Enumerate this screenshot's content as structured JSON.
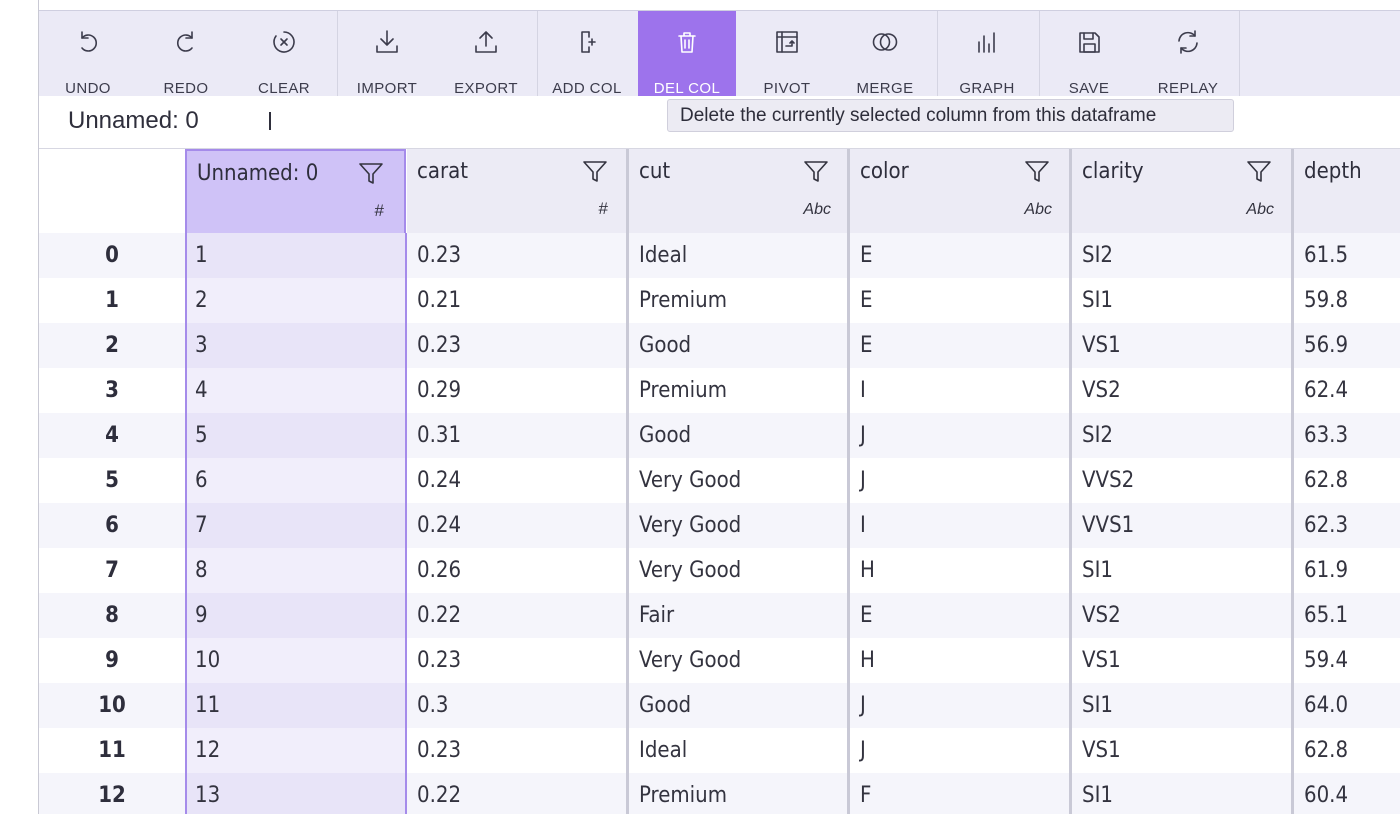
{
  "toolbar": {
    "buttons": [
      {
        "label": "UNDO",
        "icon": "undo-icon"
      },
      {
        "label": "REDO",
        "icon": "redo-icon"
      },
      {
        "label": "CLEAR",
        "icon": "clear-icon"
      },
      {
        "label": "IMPORT",
        "icon": "import-icon"
      },
      {
        "label": "EXPORT",
        "icon": "export-icon"
      },
      {
        "label": "ADD COL",
        "icon": "add-column-icon"
      },
      {
        "label": "DEL COL",
        "icon": "trash-icon"
      },
      {
        "label": "PIVOT",
        "icon": "pivot-icon"
      },
      {
        "label": "MERGE",
        "icon": "merge-icon"
      },
      {
        "label": "GRAPH",
        "icon": "graph-icon"
      },
      {
        "label": "SAVE",
        "icon": "save-icon"
      },
      {
        "label": "REPLAY",
        "icon": "replay-icon"
      }
    ],
    "active_button": "DEL COL",
    "accent_color": "#9d73ec"
  },
  "column_bar": {
    "selected_column_name": "Unnamed: 0"
  },
  "tooltip": {
    "text": "Delete the currently selected column from this dataframe"
  },
  "grid": {
    "columns": [
      {
        "name": "Unnamed: 0",
        "type_symbol": "#"
      },
      {
        "name": "carat",
        "type_symbol": "#"
      },
      {
        "name": "cut",
        "type_symbol": "Abc"
      },
      {
        "name": "color",
        "type_symbol": "Abc"
      },
      {
        "name": "clarity",
        "type_symbol": "Abc"
      },
      {
        "name": "depth",
        "type_symbol": ""
      }
    ],
    "rows": [
      {
        "index": "0",
        "cells": [
          "1",
          "0.23",
          "Ideal",
          "E",
          "SI2",
          "61.5"
        ]
      },
      {
        "index": "1",
        "cells": [
          "2",
          "0.21",
          "Premium",
          "E",
          "SI1",
          "59.8"
        ]
      },
      {
        "index": "2",
        "cells": [
          "3",
          "0.23",
          "Good",
          "E",
          "VS1",
          "56.9"
        ]
      },
      {
        "index": "3",
        "cells": [
          "4",
          "0.29",
          "Premium",
          "I",
          "VS2",
          "62.4"
        ]
      },
      {
        "index": "4",
        "cells": [
          "5",
          "0.31",
          "Good",
          "J",
          "SI2",
          "63.3"
        ]
      },
      {
        "index": "5",
        "cells": [
          "6",
          "0.24",
          "Very Good",
          "J",
          "VVS2",
          "62.8"
        ]
      },
      {
        "index": "6",
        "cells": [
          "7",
          "0.24",
          "Very Good",
          "I",
          "VVS1",
          "62.3"
        ]
      },
      {
        "index": "7",
        "cells": [
          "8",
          "0.26",
          "Very Good",
          "H",
          "SI1",
          "61.9"
        ]
      },
      {
        "index": "8",
        "cells": [
          "9",
          "0.22",
          "Fair",
          "E",
          "VS2",
          "65.1"
        ]
      },
      {
        "index": "9",
        "cells": [
          "10",
          "0.23",
          "Very Good",
          "H",
          "VS1",
          "59.4"
        ]
      },
      {
        "index": "10",
        "cells": [
          "11",
          "0.3",
          "Good",
          "J",
          "SI1",
          "64.0"
        ]
      },
      {
        "index": "11",
        "cells": [
          "12",
          "0.23",
          "Ideal",
          "J",
          "VS1",
          "62.8"
        ]
      },
      {
        "index": "12",
        "cells": [
          "13",
          "0.22",
          "Premium",
          "F",
          "SI1",
          "60.4"
        ]
      }
    ],
    "selected_column_index": 0
  }
}
